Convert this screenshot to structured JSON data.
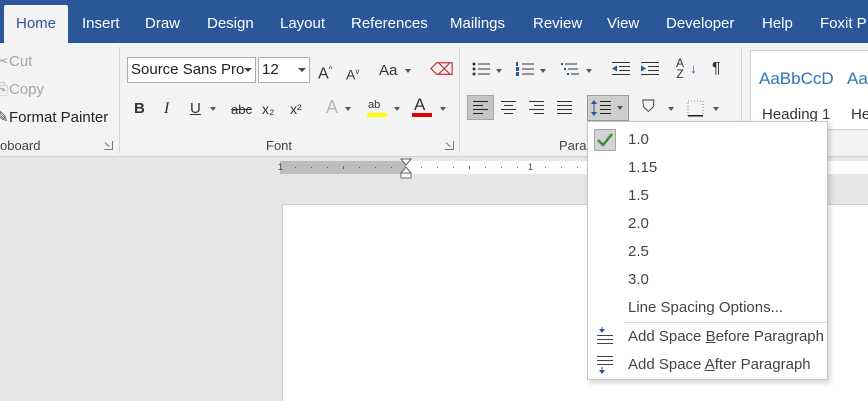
{
  "tabs": [
    {
      "label": "Home",
      "active": true
    },
    {
      "label": "Insert"
    },
    {
      "label": "Draw"
    },
    {
      "label": "Design"
    },
    {
      "label": "Layout"
    },
    {
      "label": "References"
    },
    {
      "label": "Mailings"
    },
    {
      "label": "Review"
    },
    {
      "label": "View"
    },
    {
      "label": "Developer"
    },
    {
      "label": "Help"
    },
    {
      "label": "Foxit PI"
    }
  ],
  "clipboard": {
    "cut": "Cut",
    "copy": "Copy",
    "format_painter": "Format Painter",
    "group_label": "oboard"
  },
  "font": {
    "name": "Source Sans Pro",
    "size": "12",
    "group_label": "Font",
    "bold": "B",
    "italic": "I",
    "underline": "U",
    "strike": "abc",
    "subscript": "x₂",
    "superscript": "x²",
    "grow": "A",
    "shrink": "A",
    "change_case": "Aa",
    "text_effects": "A",
    "highlight": "ab",
    "font_color": "A",
    "highlight_color": "#ffff00",
    "font_color_value": "#e00000"
  },
  "paragraph": {
    "group_label": "Parag",
    "show_marks": "¶"
  },
  "styles": {
    "items": [
      {
        "sample": "AaBbCcD",
        "name": "Heading 1"
      },
      {
        "sample": "AaB",
        "name": "He"
      }
    ]
  },
  "ruler": {
    "marks": [
      "1",
      "1"
    ]
  },
  "line_spacing_menu": {
    "selected": "1.0",
    "options": [
      "1.0",
      "1.15",
      "1.5",
      "2.0",
      "2.5",
      "3.0"
    ],
    "options_label": "Line Spacing Options...",
    "add_before": {
      "pre": "Add Space ",
      "key": "B",
      "post": "efore Paragraph"
    },
    "add_after": {
      "pre": "Add Space ",
      "key": "A",
      "post": "fter Paragraph"
    },
    "check_color": "#3a8c3a"
  },
  "colors": {
    "accent": "#2b579a",
    "ribbon": "#f3f3f3",
    "canvas": "#e6e6e6"
  }
}
